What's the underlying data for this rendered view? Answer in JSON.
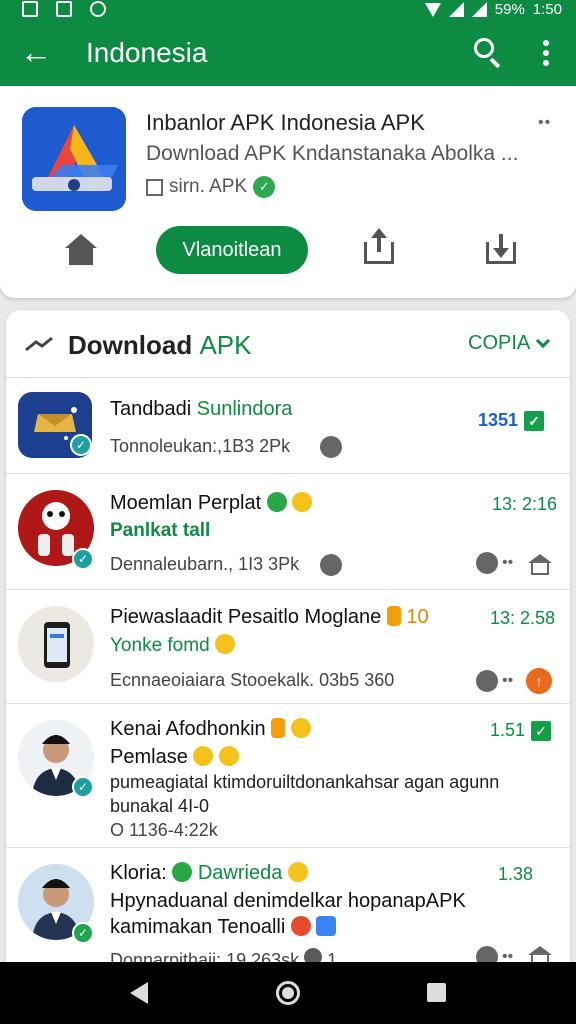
{
  "status": {
    "battery": "59%",
    "time": "1:50"
  },
  "appbar": {
    "title": "Indonesia"
  },
  "app": {
    "title": "Inbanlor APK Indonesia APK",
    "subtitle": "Download APK Kndanstanaka Abolka ...",
    "meta": "sirn. APK",
    "install_label": "Vlanoitlean"
  },
  "list": {
    "title_main": "Download",
    "title_accent": "APK",
    "sort_label": "COPIA",
    "items": [
      {
        "title": "Tandbadi",
        "title_tag": "Sunlindora",
        "meta": "Tonnoleukan:,1B3 2Pk",
        "right": "1351"
      },
      {
        "title": "Moemlan Perplat",
        "line": "Panlkat",
        "line_tag": "tall",
        "meta": "Dennaleubarn., 1I3 3Pk",
        "right": "13: 2:16"
      },
      {
        "title": "Piewaslaadit Pesaitlo Moglane",
        "title_tag": "10",
        "line": "Yonke fomd",
        "meta": "Ecnnaeoiaiara Stooekalk.",
        "meta2": "03b5 360",
        "right": "13: 2.58"
      },
      {
        "title": "Kenai Afodhonkin",
        "line_black": "Pemlase",
        "desc1": "pumeagiatal ktimdoruiltdonankahsar agan agunn",
        "desc2": "bunakal 4I-0",
        "meta": "O 1136-4:22k",
        "right": "1.51"
      },
      {
        "title": "Kloria:",
        "title_tag": "Dawrieda",
        "desc1": "Hpynaduanal denimdelkar hopanapAPK",
        "desc2": "kamimakan Tenoalli",
        "meta": "Donnarpithaii: 19 263sk",
        "meta_count": "1",
        "right": "1.38"
      }
    ]
  },
  "colors": {
    "accent": "#0d8b43",
    "link_blue": "#1a5fd1",
    "install": "#0d8b43"
  }
}
